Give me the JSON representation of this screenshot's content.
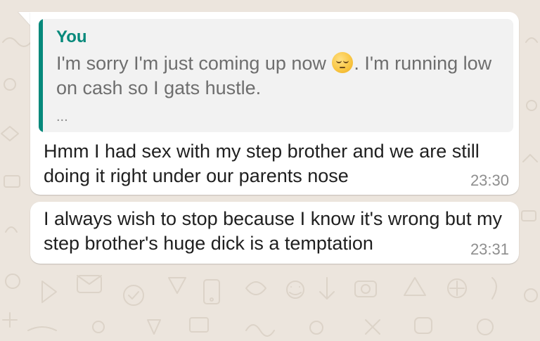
{
  "messages": [
    {
      "quote": {
        "author": "You",
        "text_before_emoji": "I'm sorry I'm just coming up now ",
        "emoji": "pensive-face-emoji",
        "text_after_emoji": ". I'm running low on cash so I gats hustle.",
        "ellipsis": "..."
      },
      "text": "Hmm I had sex with my step brother and we are still doing it right under our parents nose",
      "time": "23:30"
    },
    {
      "text": "I always wish to stop because I know it's wrong but my step brother's huge dick is a temptation",
      "time": "23:31"
    }
  ],
  "colors": {
    "background": "#ECE5DD",
    "bubble": "#FFFFFF",
    "quote_accent": "#06897B",
    "quote_background": "#F2F2F2",
    "timestamp": "#8E8E8E"
  }
}
